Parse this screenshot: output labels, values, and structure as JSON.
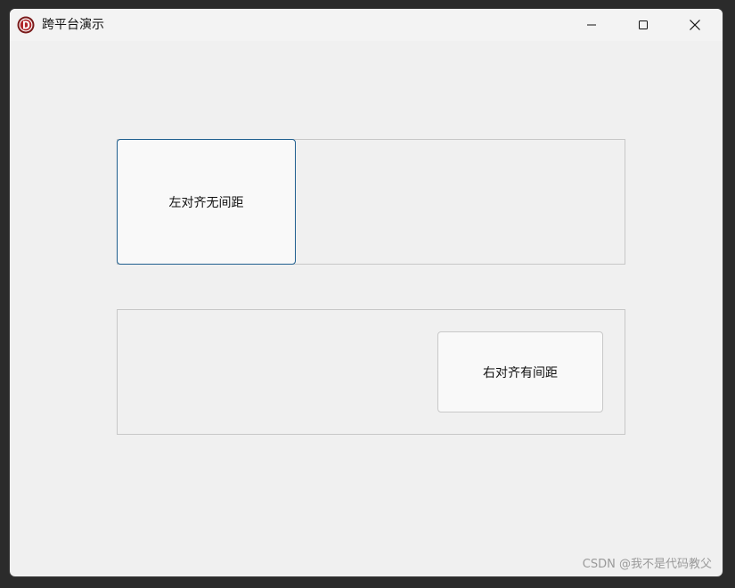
{
  "window": {
    "title": "跨平台演示",
    "icon": "delphi-logo-icon",
    "accent_color": "#1f5f8f"
  },
  "controls": {
    "minimize_icon": "minimize-icon",
    "maximize_icon": "maximize-icon",
    "close_icon": "close-icon"
  },
  "buttons": {
    "left_aligned_label": "左对齐无间距",
    "right_aligned_label": "右对齐有间距"
  },
  "watermark": {
    "text": "CSDN @我不是代码教父"
  }
}
